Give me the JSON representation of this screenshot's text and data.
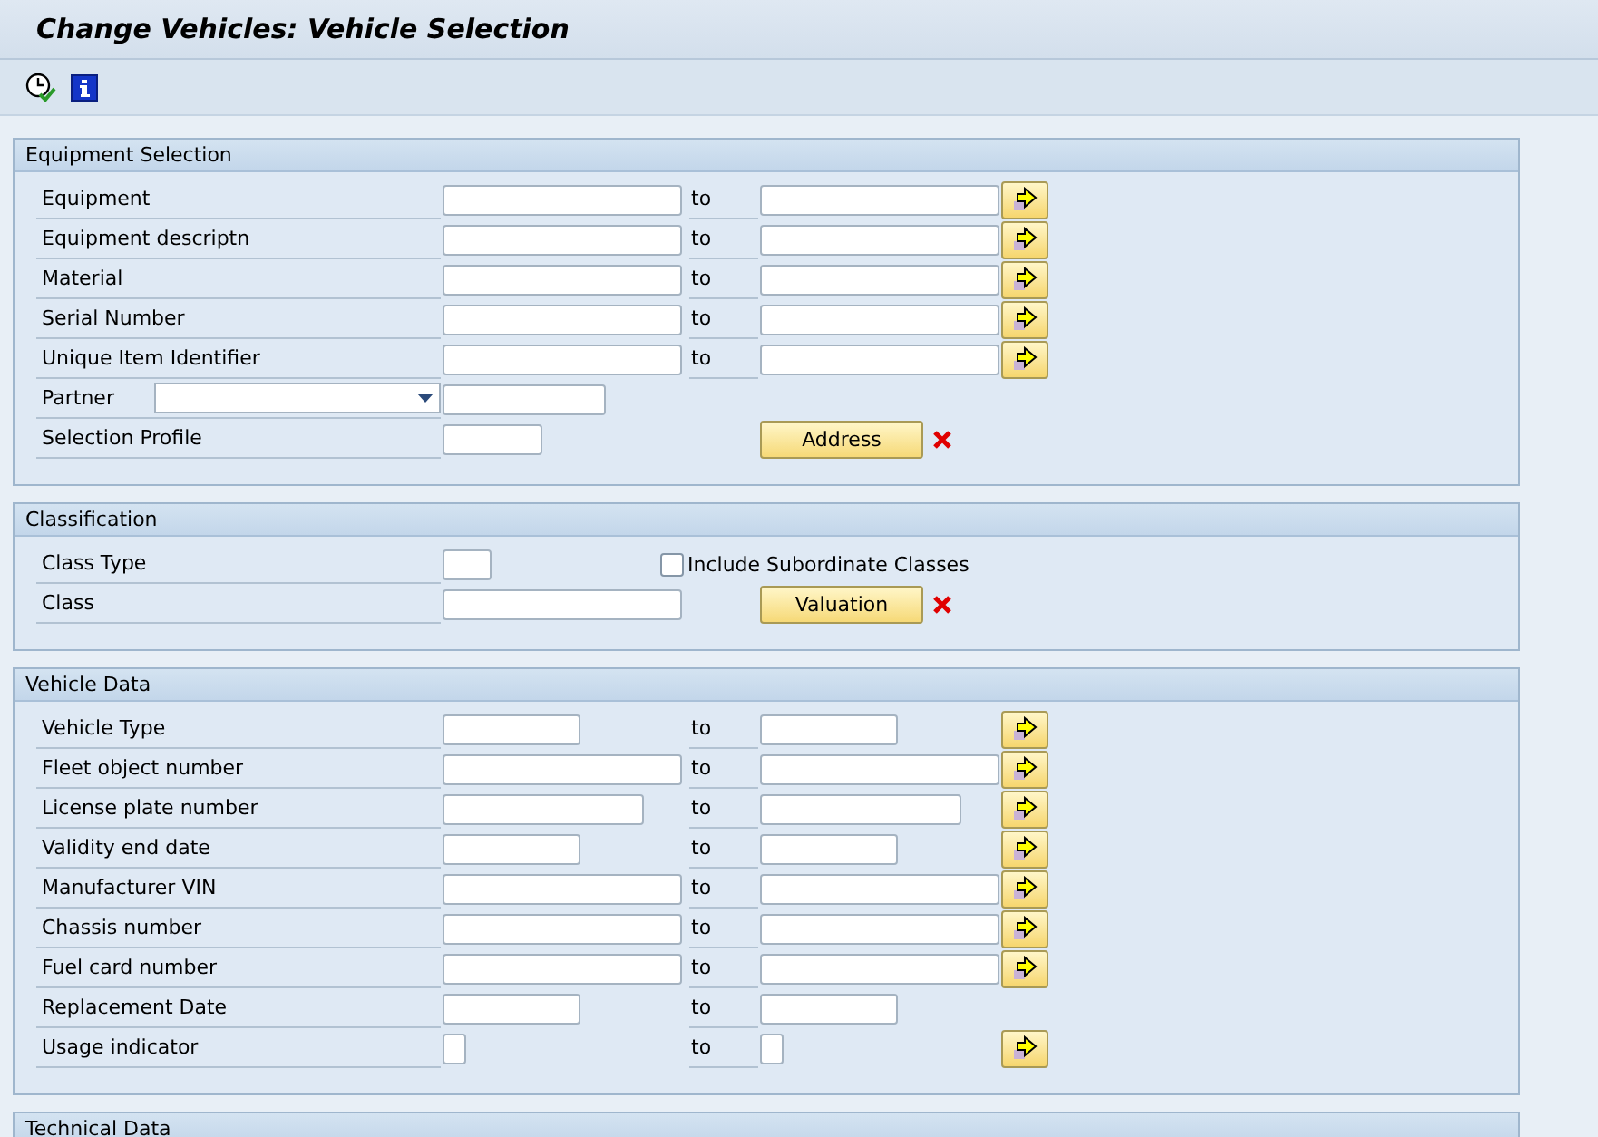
{
  "title": "Change Vehicles: Vehicle Selection",
  "sections": [
    {
      "title": "Equipment Selection",
      "rows": [
        {
          "kind": "range",
          "label": "Equipment",
          "to": "to",
          "multi": true
        },
        {
          "kind": "range",
          "label": "Equipment descriptn",
          "to": "to",
          "multi": true
        },
        {
          "kind": "range",
          "label": "Material",
          "to": "to",
          "multi": true
        },
        {
          "kind": "range",
          "label": "Serial Number",
          "to": "to",
          "multi": true
        },
        {
          "kind": "range",
          "label": "Unique Item Identifier",
          "to": "to",
          "multi": true
        },
        {
          "kind": "partner",
          "label": "Partner"
        },
        {
          "kind": "profile",
          "label": "Selection Profile",
          "button": "Address",
          "delete": true
        }
      ]
    },
    {
      "title": "Classification",
      "rows": [
        {
          "kind": "classtype",
          "label": "Class Type",
          "checkbox": {
            "label": "Include Subordinate Classes",
            "checked": false
          }
        },
        {
          "kind": "class",
          "label": "Class",
          "button": "Valuation",
          "delete": true
        }
      ]
    },
    {
      "title": "Vehicle Data",
      "rows": [
        {
          "kind": "daterange",
          "label": "Vehicle Type",
          "to": "to",
          "multi": true
        },
        {
          "kind": "range",
          "label": "Fleet object number",
          "to": "to",
          "multi": true
        },
        {
          "kind": "midrange",
          "label": "License plate number",
          "to": "to",
          "multi": true
        },
        {
          "kind": "daterange",
          "label": "Validity end date",
          "to": "to",
          "multi": true
        },
        {
          "kind": "range",
          "label": "Manufacturer VIN",
          "to": "to",
          "multi": true
        },
        {
          "kind": "range",
          "label": "Chassis number",
          "to": "to",
          "multi": true
        },
        {
          "kind": "range",
          "label": "Fuel card number",
          "to": "to",
          "multi": true
        },
        {
          "kind": "daterange",
          "label": "Replacement Date",
          "to": "to",
          "multi": false
        },
        {
          "kind": "flagrange",
          "label": "Usage indicator",
          "to": "to",
          "multi": true
        }
      ]
    },
    {
      "title": "Technical Data"
    }
  ]
}
